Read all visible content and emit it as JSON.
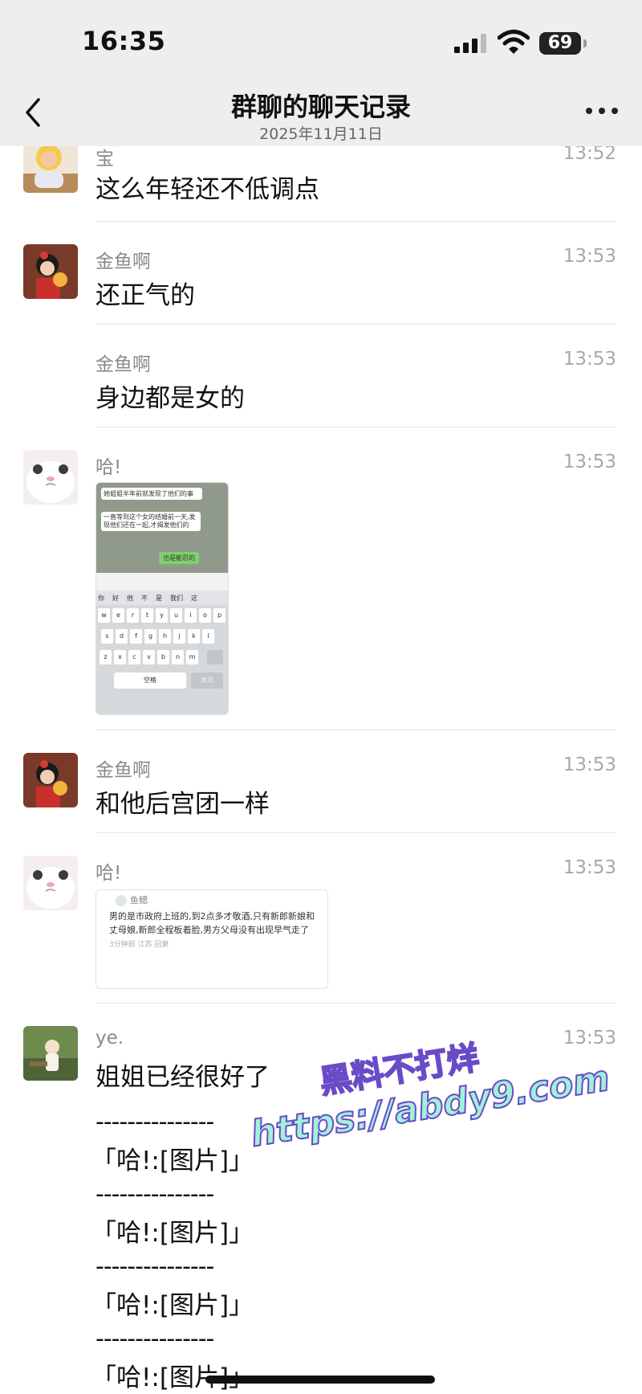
{
  "status": {
    "time": "16:35",
    "battery": "69"
  },
  "nav": {
    "title": "群聊的聊天记录",
    "subtitle": "2025年11月11日"
  },
  "messages": [
    {
      "name": "宝",
      "time": "13:52",
      "text": "这么年轻还不低调点"
    },
    {
      "name": "金鱼啊",
      "time": "13:53",
      "text": "还正气的"
    },
    {
      "name": "金鱼啊",
      "time": "13:53",
      "text": "身边都是女的"
    },
    {
      "name": "哈!",
      "time": "13:53",
      "image": {
        "bubble1": "她姐姐半年前就发现了他们的事",
        "bubble2": "一直等到这个女的结婚前一天,发现他们还在一起,才揭发他们的",
        "bubble3": "也是能忍的",
        "suggest": [
          "你",
          "好",
          "他",
          "不",
          "是",
          "我们",
          "这"
        ],
        "row1": [
          "w",
          "e",
          "r",
          "t",
          "y",
          "u",
          "i",
          "o",
          "p"
        ],
        "row2": [
          "s",
          "d",
          "f",
          "g",
          "h",
          "j",
          "k",
          "l"
        ],
        "row3": [
          "z",
          "x",
          "c",
          "v",
          "b",
          "n",
          "m"
        ],
        "space": "空格",
        "send": "发送"
      }
    },
    {
      "name": "金鱼啊",
      "time": "13:53",
      "text": "和他后宫团一样"
    },
    {
      "name": "哈!",
      "time": "13:53",
      "card": {
        "author": "鱼鳃",
        "text": "男的是市政府上班的,到2点多才敬酒,只有新郎新娘和丈母娘,新郎全程板着脸,男方父母没有出现早气走了",
        "meta": "3分钟前 江苏 回复"
      }
    },
    {
      "name": "ye.",
      "time": "13:53",
      "text": "姐姐已经很好了"
    }
  ],
  "separator": "---------------",
  "quotes": [
    "「哈!:[图片]」",
    "「哈!:[图片]」",
    "「哈!:[图片]」",
    "「哈!:[图片]」"
  ],
  "watermark": {
    "line1": "黑料不打烊",
    "line2": "https://abdy9.com"
  }
}
